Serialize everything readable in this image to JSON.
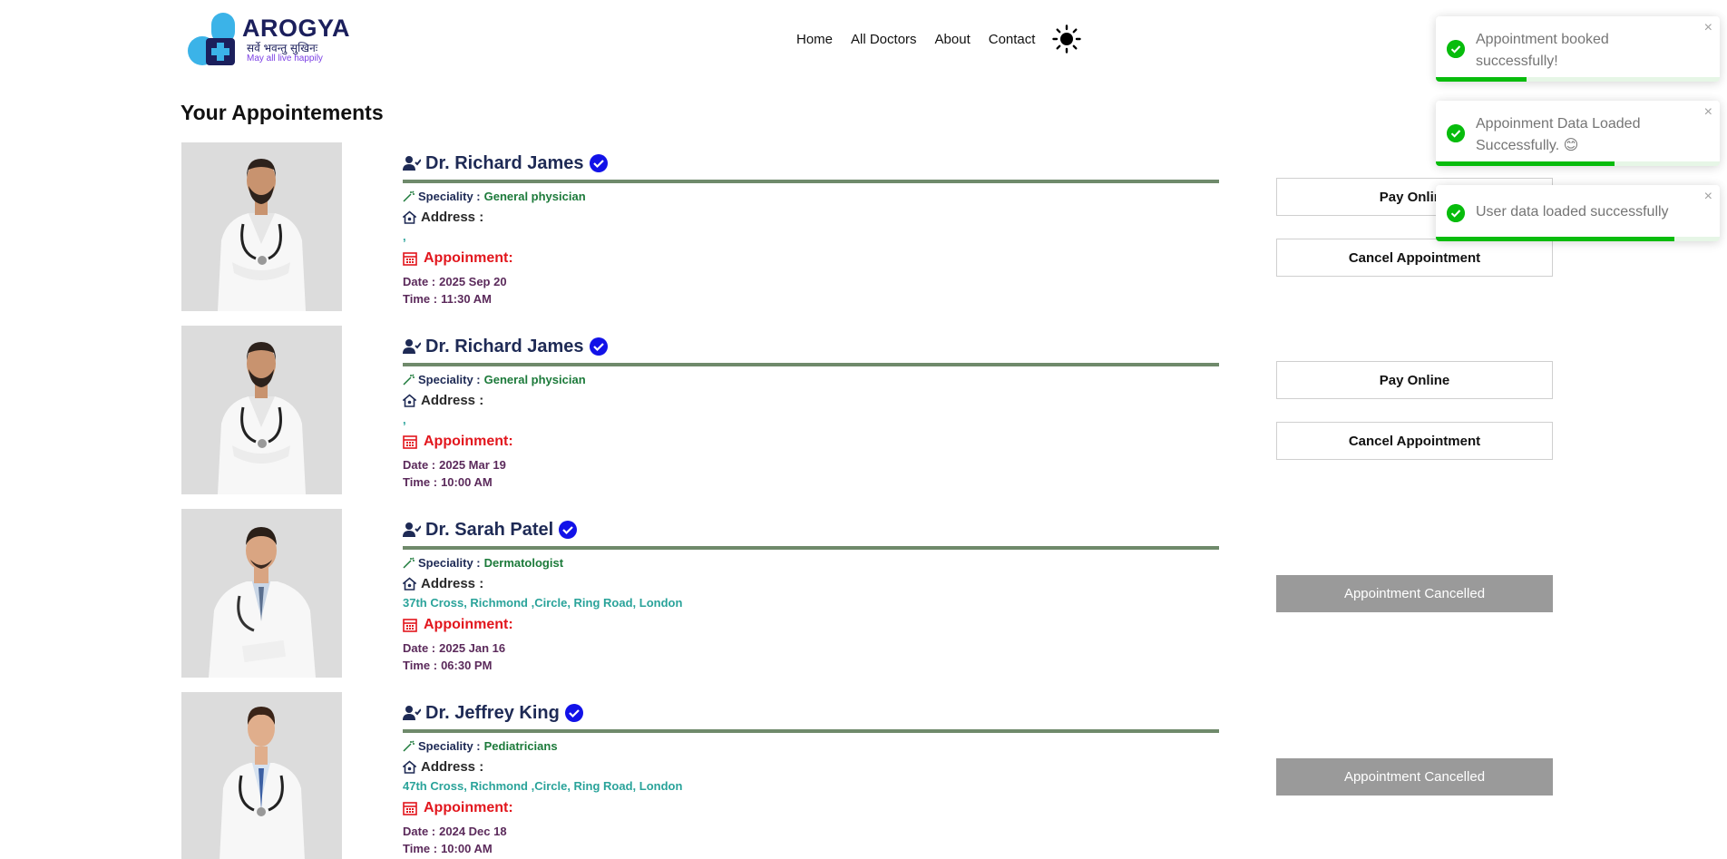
{
  "brand": {
    "name": "AROGYA",
    "sanskrit": "सर्वे भवन्तु सुखिनः",
    "tagline": "May all live happily",
    "colors": {
      "navy": "#1b1f5c",
      "sky": "#3bb3e8",
      "purple": "#7b3fe4"
    }
  },
  "nav": {
    "items": [
      "Home",
      "All Doctors",
      "About",
      "Contact"
    ],
    "theme_icon": "sun-icon"
  },
  "page": {
    "title": "Your Appointements"
  },
  "labels": {
    "speciality": "Speciality :",
    "address": "Address :",
    "appointment": "Appoinment:",
    "date": "Date :",
    "time": "Time :"
  },
  "appointments": [
    {
      "doctor": "Dr. Richard James",
      "speciality": "General physician",
      "address": ",",
      "date": "2025 Sep 20",
      "time": "11:30 AM",
      "status": "active",
      "pay_label": "Pay Online",
      "cancel_label": "Cancel Appointment"
    },
    {
      "doctor": "Dr. Richard James",
      "speciality": "General physician",
      "address": ",",
      "date": "2025 Mar 19",
      "time": "10:00 AM",
      "status": "active",
      "pay_label": "Pay Online",
      "cancel_label": "Cancel Appointment"
    },
    {
      "doctor": "Dr. Sarah Patel",
      "speciality": "Dermatologist",
      "address": "37th Cross, Richmond ,Circle, Ring Road, London",
      "date": "2025 Jan 16",
      "time": "06:30 PM",
      "status": "cancelled",
      "cancelled_label": "Appointment Cancelled"
    },
    {
      "doctor": "Dr. Jeffrey King",
      "speciality": "Pediatricians",
      "address": "47th Cross, Richmond ,Circle, Ring Road, London",
      "date": "2024 Dec 18",
      "time": "10:00 AM",
      "status": "cancelled",
      "cancelled_label": "Appointment Cancelled"
    }
  ],
  "toasts": [
    {
      "message": "Appointment booked successfully!",
      "progress": 0.32,
      "close": "×"
    },
    {
      "message": "Appoinment Data Loaded Successfully. 😊",
      "progress": 0.63,
      "close": "×"
    },
    {
      "message": "User data loaded successfully",
      "progress": 0.84,
      "close": "×"
    }
  ],
  "colors": {
    "success": "#07bc0c",
    "doctor_name": "#1e2a55",
    "speciality": "#1c7a3a",
    "address_value": "#2aa39a",
    "appointment": "#e2161d",
    "datetime": "#5b2a5b",
    "divider": "#6f8a6b",
    "verified": "#1212e8",
    "cancelled_bg": "#9a9a9a"
  }
}
